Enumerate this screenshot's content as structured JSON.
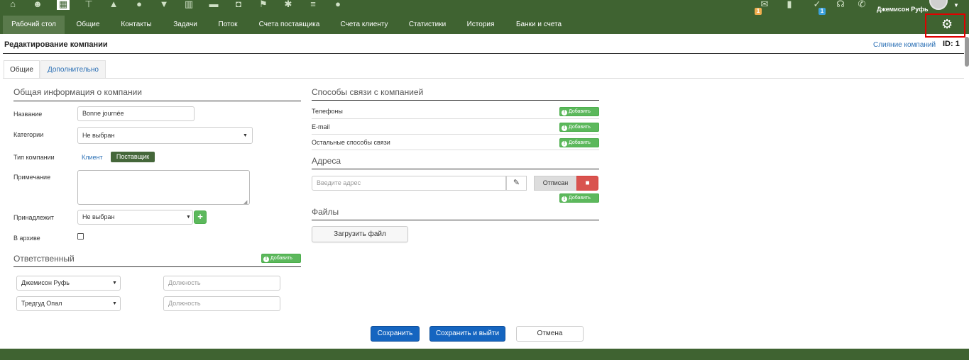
{
  "topbar": {
    "icons": [
      "home-icon",
      "user-plus-icon",
      "calendar-icon",
      "sitemap-icon",
      "road-icon",
      "bell-icon",
      "filter-icon",
      "bar-chart-icon",
      "spy-icon",
      "money-bag-icon",
      "flag-icon",
      "cogs-icon",
      "list-icon",
      "info-icon"
    ],
    "mail_badge": "1",
    "tasks_badge": "1",
    "user_name": "Джемисон Руфь"
  },
  "nav": {
    "items": [
      "Рабочий стол",
      "Общие",
      "Контакты",
      "Задачи",
      "Поток",
      "Счета поставщика",
      "Счета клиенту",
      "Статистики",
      "История",
      "Банки и счета"
    ],
    "active_index": 0,
    "settings_icon": "gear-icon"
  },
  "page": {
    "title": "Редактирование компании",
    "merge_link": "Слияние компаний",
    "id_label": "ID: 1"
  },
  "tabs": [
    "Общие",
    "Дополнительно"
  ],
  "general": {
    "section_title": "Общая информация о компании",
    "name_label": "Название",
    "name_value": "Bonne journée",
    "categories_label": "Категории",
    "categories_value": "Не выбран",
    "type_label": "Тип компании",
    "type_client": "Клиент",
    "type_supplier": "Поставщик",
    "note_label": "Примечание",
    "belongs_label": "Принадлежит",
    "belongs_value": "Не выбран",
    "archive_label": "В архиве"
  },
  "responsible": {
    "section_title": "Ответственный",
    "add_label": "Добавить",
    "rows": [
      {
        "person": "Джемисон Руфь",
        "position_placeholder": "Должность"
      },
      {
        "person": "Тредгуд Опал",
        "position_placeholder": "Должность"
      }
    ]
  },
  "contacts": {
    "section_title": "Способы связи с компанией",
    "rows": [
      "Телефоны",
      "E-mail",
      "Остальные способы связи"
    ],
    "add_label": "Добавить"
  },
  "addresses": {
    "section_title": "Адреса",
    "placeholder": "Введите адрес",
    "status": "Отписан",
    "add_label": "Добавить"
  },
  "files": {
    "section_title": "Файлы",
    "upload_label": "Загрузить файл"
  },
  "actions": {
    "save": "Сохранить",
    "save_exit": "Сохранить и выйти",
    "cancel": "Отмена"
  },
  "colors": {
    "brand_green": "#3f6331",
    "primary_blue": "#1565c0",
    "success_green": "#5cb85c",
    "danger_red": "#d9534f",
    "highlight_red": "#e00000"
  }
}
